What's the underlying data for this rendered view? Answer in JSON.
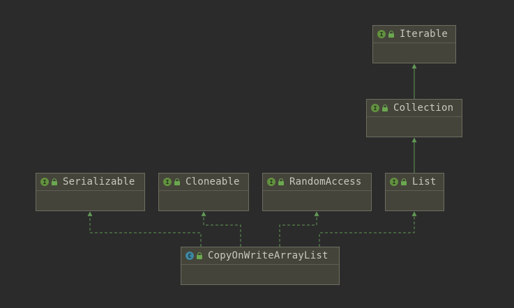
{
  "diagram": {
    "nodes": {
      "iterable": {
        "name": "Iterable",
        "kind": "interface",
        "badge": "I"
      },
      "collection": {
        "name": "Collection",
        "kind": "interface",
        "badge": "I"
      },
      "serializable": {
        "name": "Serializable",
        "kind": "interface",
        "badge": "I"
      },
      "cloneable": {
        "name": "Cloneable",
        "kind": "interface",
        "badge": "I"
      },
      "randomaccess": {
        "name": "RandomAccess",
        "kind": "interface",
        "badge": "I"
      },
      "list": {
        "name": "List",
        "kind": "interface",
        "badge": "I"
      },
      "cowal": {
        "name": "CopyOnWriteArrayList",
        "kind": "class",
        "badge": "C"
      }
    },
    "edges": [
      {
        "from": "collection",
        "to": "iterable",
        "type": "extends"
      },
      {
        "from": "list",
        "to": "collection",
        "type": "extends"
      },
      {
        "from": "cowal",
        "to": "serializable",
        "type": "implements"
      },
      {
        "from": "cowal",
        "to": "cloneable",
        "type": "implements"
      },
      {
        "from": "cowal",
        "to": "randomaccess",
        "type": "implements"
      },
      {
        "from": "cowal",
        "to": "list",
        "type": "implements"
      }
    ],
    "colors": {
      "background": "#2b2b2b",
      "node_fill": "#45443a",
      "node_border": "#6e6d62",
      "edge": "#629755",
      "interface_badge": "#62913f",
      "class_badge": "#3e86a0"
    }
  }
}
